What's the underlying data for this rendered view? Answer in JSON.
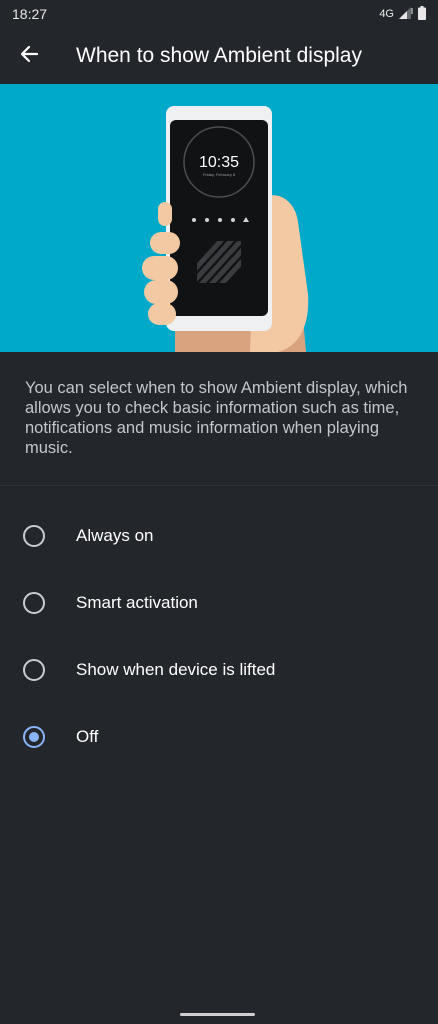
{
  "status_bar": {
    "time": "18:27",
    "network": "4G",
    "signal_icon": "signal-icon",
    "battery_icon": "battery-icon"
  },
  "app_bar": {
    "title": "When to show Ambient display",
    "back_icon": "arrow-back-icon"
  },
  "hero": {
    "clock_time": "10:35",
    "clock_date": "Friday, February 8"
  },
  "description": "You can select when to show Ambient display, which allows you to check basic information such as time, notifications and music information when playing music.",
  "options": [
    {
      "label": "Always on",
      "selected": false
    },
    {
      "label": "Smart activation",
      "selected": false
    },
    {
      "label": "Show when device is lifted",
      "selected": false
    },
    {
      "label": "Off",
      "selected": true
    }
  ],
  "colors": {
    "background": "#23272c",
    "hero_background": "#00a9c9",
    "accent": "#8ab4f8"
  }
}
